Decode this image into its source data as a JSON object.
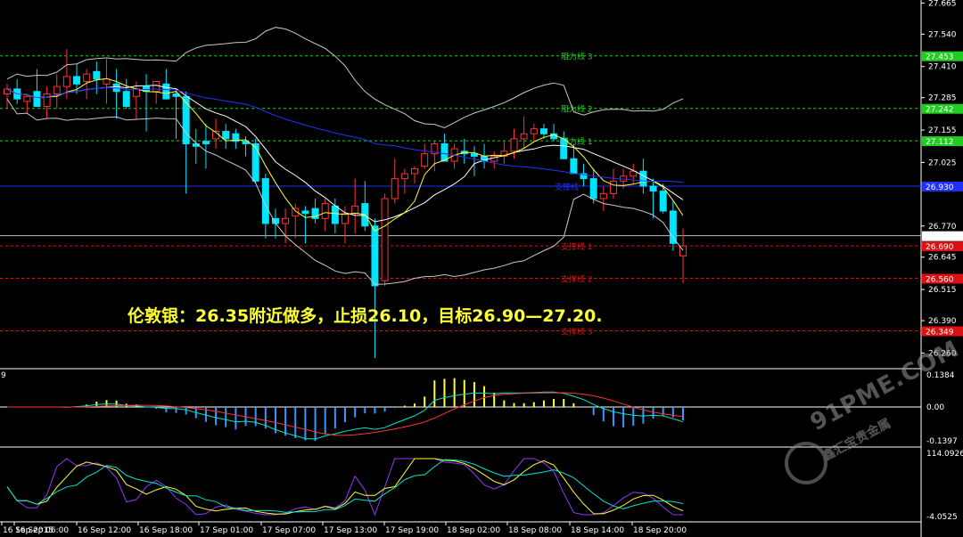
{
  "chart_data": {
    "type": "candlestick",
    "price_axis": {
      "ticks": [
        "27.665",
        "27.540",
        "27.410",
        "27.285",
        "27.155",
        "27.025",
        "26.770",
        "26.645",
        "26.515",
        "26.390",
        "26.260"
      ],
      "ylim": [
        26.19,
        27.67
      ]
    },
    "time_axis": {
      "ticks": [
        "16 Sep 2015",
        "16 Sep 06:00",
        "16 Sep 12:00",
        "16 Sep 18:00",
        "17 Sep 01:00",
        "17 Sep 07:00",
        "17 Sep 13:00",
        "17 Sep 19:00",
        "18 Sep 02:00",
        "18 Sep 08:00",
        "18 Sep 14:00",
        "18 Sep 20:00"
      ]
    },
    "levels": [
      {
        "name": "阻力线 3",
        "value": 27.453,
        "label": "27.453",
        "color": "#22cc22"
      },
      {
        "name": "阻力线 2",
        "value": 27.242,
        "label": "27.242",
        "color": "#22cc22"
      },
      {
        "name": "阻力线 1",
        "value": 27.112,
        "label": "27.112",
        "color": "#22cc22"
      },
      {
        "name": "支撑线",
        "value": 26.93,
        "label": "26.930",
        "color": "#2030ff"
      },
      {
        "name": "支撑线 1",
        "value": 26.69,
        "label": "26.690",
        "color": "#dd1111"
      },
      {
        "name": "支撑线 2",
        "value": 26.56,
        "label": "26.560",
        "color": "#dd1111"
      },
      {
        "name": "支撑线 3",
        "value": 26.349,
        "label": "26.349",
        "color": "#dd1111"
      }
    ],
    "current_price": {
      "value": 26.731,
      "label": "26.731"
    },
    "candles": [
      [
        27.3,
        27.34,
        27.24,
        27.32
      ],
      [
        27.32,
        27.36,
        27.26,
        27.28
      ],
      [
        27.27,
        27.3,
        27.22,
        27.29
      ],
      [
        27.31,
        27.4,
        27.26,
        27.25
      ],
      [
        27.25,
        27.33,
        27.2,
        27.3
      ],
      [
        27.3,
        27.38,
        27.24,
        27.33
      ],
      [
        27.33,
        27.48,
        27.28,
        27.37
      ],
      [
        27.37,
        27.42,
        27.3,
        27.34
      ],
      [
        27.35,
        27.4,
        27.28,
        27.38
      ],
      [
        27.39,
        27.43,
        27.3,
        27.36
      ],
      [
        27.34,
        27.44,
        27.26,
        27.36
      ],
      [
        27.34,
        27.4,
        27.2,
        27.31
      ],
      [
        27.31,
        27.36,
        27.24,
        27.25
      ],
      [
        27.29,
        27.35,
        27.2,
        27.32
      ],
      [
        27.33,
        27.38,
        27.15,
        27.31
      ],
      [
        27.31,
        27.34,
        27.26,
        27.35
      ],
      [
        27.34,
        27.4,
        27.28,
        27.28
      ],
      [
        27.3,
        27.32,
        27.12,
        27.29
      ],
      [
        27.29,
        27.31,
        26.9,
        27.1
      ],
      [
        27.1,
        27.16,
        27.02,
        27.09
      ],
      [
        27.11,
        27.18,
        27.0,
        27.1
      ],
      [
        27.12,
        27.2,
        27.08,
        27.15
      ],
      [
        27.15,
        27.18,
        27.08,
        27.12
      ],
      [
        27.14,
        27.16,
        27.08,
        27.11
      ],
      [
        27.11,
        27.13,
        27.05,
        27.1
      ],
      [
        27.1,
        27.12,
        26.94,
        26.95
      ],
      [
        26.96,
        26.98,
        26.72,
        26.78
      ],
      [
        26.8,
        26.84,
        26.72,
        26.78
      ],
      [
        26.78,
        26.84,
        26.7,
        26.8
      ],
      [
        26.81,
        26.86,
        26.72,
        26.84
      ],
      [
        26.83,
        26.85,
        26.7,
        26.82
      ],
      [
        26.84,
        26.88,
        26.78,
        26.8
      ],
      [
        26.8,
        26.88,
        26.75,
        26.86
      ],
      [
        26.85,
        26.88,
        26.74,
        26.78
      ],
      [
        26.78,
        26.85,
        26.7,
        26.82
      ],
      [
        26.82,
        26.96,
        26.74,
        26.85
      ],
      [
        26.86,
        26.95,
        26.75,
        26.77
      ],
      [
        26.77,
        26.8,
        26.24,
        26.53
      ],
      [
        26.55,
        26.9,
        26.53,
        26.88
      ],
      [
        26.88,
        27.04,
        26.86,
        26.96
      ],
      [
        26.96,
        27.0,
        26.9,
        26.98
      ],
      [
        26.98,
        27.01,
        26.94,
        27.0
      ],
      [
        27.01,
        27.1,
        27.0,
        27.06
      ],
      [
        27.06,
        27.11,
        26.99,
        27.1
      ],
      [
        27.1,
        27.14,
        27.04,
        27.03
      ],
      [
        27.03,
        27.1,
        27.0,
        27.08
      ],
      [
        27.07,
        27.12,
        27.02,
        27.06
      ],
      [
        27.06,
        27.09,
        26.97,
        27.05
      ],
      [
        27.05,
        27.1,
        27.0,
        27.03
      ],
      [
        27.03,
        27.07,
        27.0,
        27.05
      ],
      [
        27.05,
        27.11,
        27.02,
        27.07
      ],
      [
        27.07,
        27.16,
        27.04,
        27.12
      ],
      [
        27.12,
        27.21,
        27.08,
        27.14
      ],
      [
        27.14,
        27.18,
        27.11,
        27.16
      ],
      [
        27.16,
        27.18,
        27.12,
        27.14
      ],
      [
        27.14,
        27.18,
        27.11,
        27.12
      ],
      [
        27.12,
        27.15,
        27.05,
        27.04
      ],
      [
        27.04,
        27.1,
        26.99,
        26.98
      ],
      [
        26.98,
        27.02,
        26.93,
        26.96
      ],
      [
        26.96,
        27.0,
        26.86,
        26.88
      ],
      [
        26.88,
        26.93,
        26.83,
        26.9
      ],
      [
        26.9,
        27.0,
        26.88,
        26.95
      ],
      [
        26.95,
        27.0,
        26.92,
        26.97
      ],
      [
        26.97,
        27.02,
        26.94,
        26.99
      ],
      [
        26.99,
        27.04,
        26.9,
        26.93
      ],
      [
        26.93,
        26.96,
        26.8,
        26.91
      ],
      [
        26.91,
        26.94,
        26.82,
        26.83
      ],
      [
        26.83,
        26.87,
        26.67,
        26.7
      ],
      [
        26.65,
        26.76,
        26.54,
        26.69
      ]
    ],
    "indicators": {
      "macd": {
        "ticks": [
          "0.1384",
          "0.00",
          "-0.1397"
        ]
      },
      "oscillator": {
        "ticks": [
          "114.0926",
          "-4.0525"
        ]
      }
    },
    "colors": {
      "up": "#000000",
      "up_border": "#ffffff",
      "down": "#00e5ff",
      "bullish_wick": "#ff3333",
      "ma_fast": "#ffff33",
      "ma_mid": "#ffffff",
      "ma_slow": "#2233ff",
      "band": "#c8c8c8"
    }
  },
  "annotation": {
    "text": "伦敦银：26.35附近做多，止损26.10，目标26.90—27.20."
  },
  "panel_label": "9",
  "watermark": {
    "brand": "91PME.COM",
    "sub": "鑫汇宝贵金属"
  }
}
